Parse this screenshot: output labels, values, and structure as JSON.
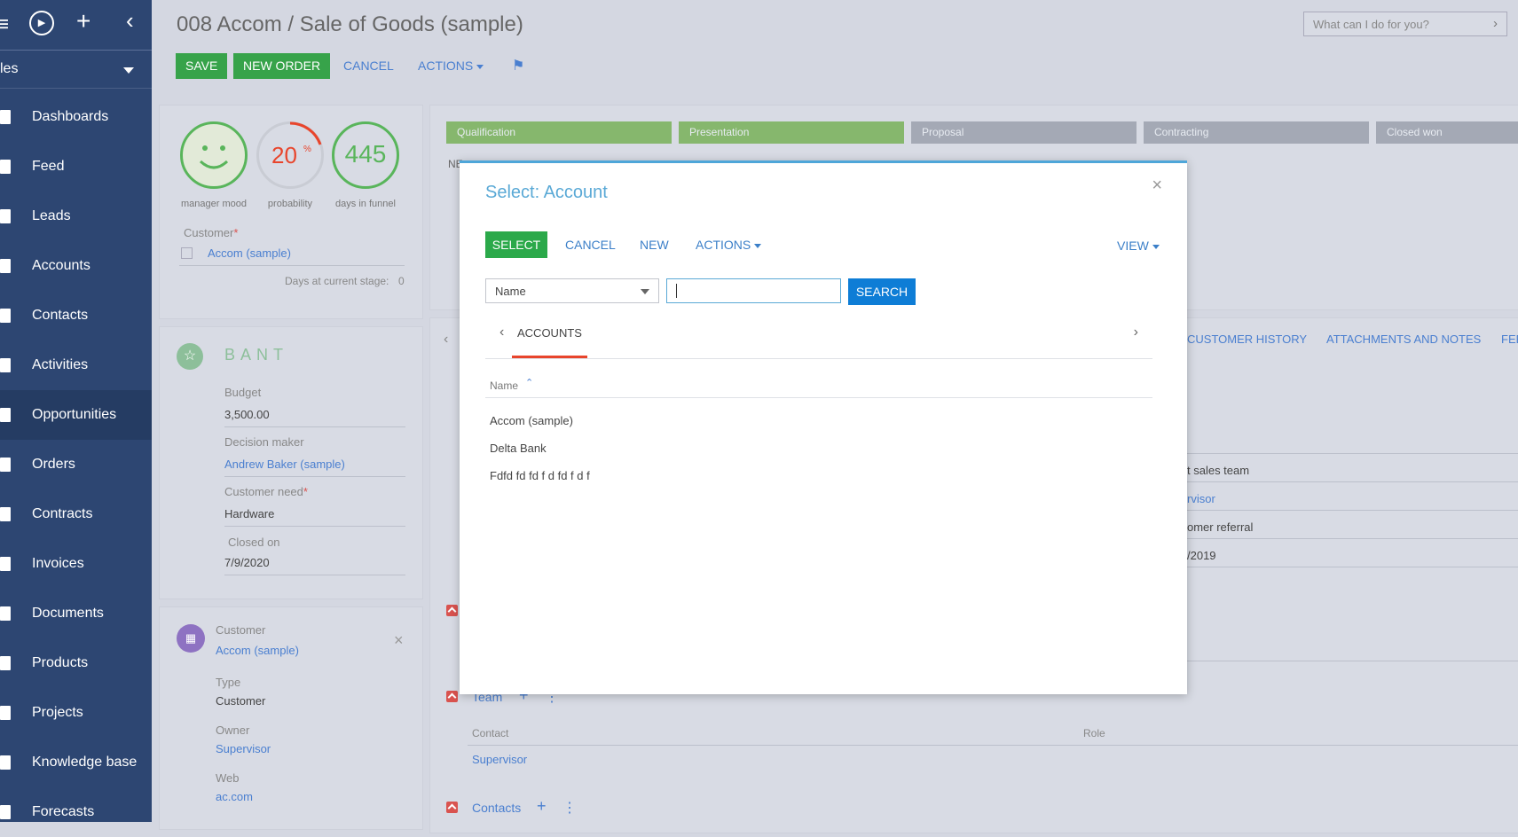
{
  "sidebar": {
    "section": "les",
    "items": [
      {
        "label": "Dashboards"
      },
      {
        "label": "Feed"
      },
      {
        "label": "Leads"
      },
      {
        "label": "Accounts"
      },
      {
        "label": "Contacts"
      },
      {
        "label": "Activities"
      },
      {
        "label": "Opportunities",
        "active": true
      },
      {
        "label": "Orders"
      },
      {
        "label": "Contracts"
      },
      {
        "label": "Invoices"
      },
      {
        "label": "Documents"
      },
      {
        "label": "Products"
      },
      {
        "label": "Projects"
      },
      {
        "label": "Knowledge base"
      },
      {
        "label": "Forecasts"
      }
    ]
  },
  "header": {
    "title": "008 Accom / Sale of Goods (sample)",
    "save_label": "SAVE",
    "new_order_label": "NEW ORDER",
    "cancel_label": "CANCEL",
    "actions_label": "ACTIONS",
    "search_placeholder": "What can I do for you?"
  },
  "summary": {
    "mood_caption": "manager mood",
    "probability_value": "20",
    "probability_unit": "%",
    "probability_caption": "probability",
    "days_value": "445",
    "days_caption": "days in funnel",
    "customer_label": "Customer",
    "customer_value": "Accom (sample)",
    "days_stage_label": "Days at current stage:",
    "days_stage_value": "0"
  },
  "bant": {
    "title": "BANT",
    "budget_label": "Budget",
    "budget_value": "3,500.00",
    "decision_maker_label": "Decision maker",
    "decision_maker_value": "Andrew Baker (sample)",
    "need_label": "Customer need",
    "need_value": "Hardware",
    "closed_label": "Closed on",
    "closed_value": "7/9/2020"
  },
  "customer_card": {
    "label": "Customer",
    "name": "Accom (sample)",
    "type_label": "Type",
    "type_value": "Customer",
    "owner_label": "Owner",
    "owner_value": "Supervisor",
    "web_label": "Web",
    "web_value": "ac.com"
  },
  "stages": [
    "Qualification",
    "Presentation",
    "Proposal",
    "Contracting",
    "Closed won"
  ],
  "stage_row_prefix": "NE",
  "bg_tabs": {
    "history": "CUSTOMER HISTORY",
    "attachments": "ATTACHMENTS AND NOTES",
    "feed": "FEE"
  },
  "bg_fields": {
    "f1": "t sales team",
    "f2": "rvisor",
    "f3": "omer referral",
    "f4": "/2019"
  },
  "team": {
    "title": "Team",
    "contact_col": "Contact",
    "role_col": "Role",
    "row_contact": "Supervisor"
  },
  "contacts_section": {
    "title": "Contacts"
  },
  "modal": {
    "title": "Select: Account",
    "select_label": "SELECT",
    "cancel_label": "CANCEL",
    "new_label": "NEW",
    "actions_label": "ACTIONS",
    "view_label": "VIEW",
    "field_value": "Name",
    "search_label": "SEARCH",
    "tab_label": "ACCOUNTS",
    "column_name": "Name",
    "rows": [
      "Accom (sample)",
      "Delta Bank",
      "Fdfd fd fd f d fd f d f"
    ]
  }
}
